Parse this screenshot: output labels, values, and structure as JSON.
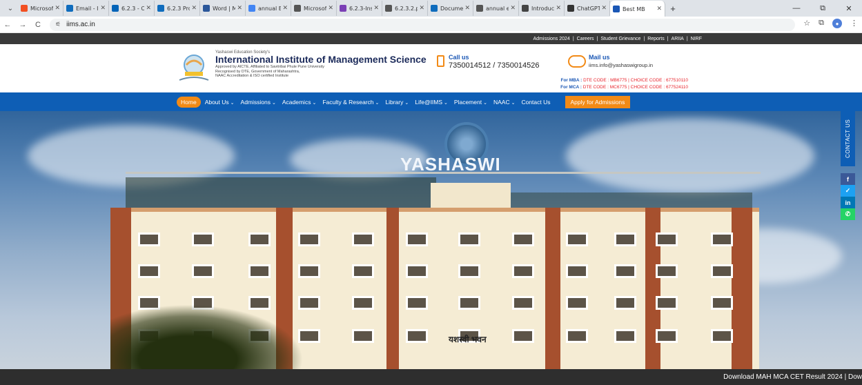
{
  "browser": {
    "tabs": [
      {
        "label": "Microsof",
        "color": "#f25022"
      },
      {
        "label": "Email - I",
        "color": "#0f6cbd"
      },
      {
        "label": "6.2.3 - O",
        "color": "#0364b8"
      },
      {
        "label": "6.2.3 Pro",
        "color": "#0f6cbd"
      },
      {
        "label": "Word | M",
        "color": "#2b579a"
      },
      {
        "label": "annual E",
        "color": "#4285f4"
      },
      {
        "label": "Microsof",
        "color": "#555555"
      },
      {
        "label": "6.2.3-Ins",
        "color": "#7b3fb5"
      },
      {
        "label": "6.2.3.2.p",
        "color": "#555555"
      },
      {
        "label": "Docume",
        "color": "#0f6cbd"
      },
      {
        "label": "annual e",
        "color": "#555555"
      },
      {
        "label": "Introduc",
        "color": "#444444"
      },
      {
        "label": "ChatGPT",
        "color": "#333333"
      },
      {
        "label": "Best MB",
        "color": "#1a57b5",
        "active": true
      }
    ],
    "new_tab": "+",
    "minimize": "—",
    "restore": "⧉",
    "close": "✕",
    "back": "←",
    "forward": "→",
    "reload": "C",
    "url": "iims.ac.in",
    "site_icon": "⚟",
    "star": "☆",
    "extensions": "⧉",
    "menu": "⋮"
  },
  "topstrip": {
    "links": [
      "Admissions 2024",
      "Careers",
      "Student Grievance",
      "Reports",
      "ARIIA",
      "NIRF"
    ]
  },
  "header": {
    "society": "Yashaswi Education Society's",
    "name": "International Institute of Management Science",
    "sub1": "Approved by AICTE, Affiliated to Savitribai Phule Pune University",
    "sub2": "Recognised by DTE, Government of Maharashtra,",
    "sub3": "NAAC Accreditation & ISO certified Institute",
    "call_title": "Call us",
    "call_number": "7350014512 / 7350014526",
    "mail_title": "Mail us",
    "mail_address": "iims.info@yashaswigroup.in",
    "mba_label": "For MBA :",
    "mba_dte": "DTE CODE : MB6775",
    "mba_choice": "CHOICE CODE : 677510110",
    "mca_label": "For MCA :",
    "mca_dte": "DTE CODE : MC6775",
    "mca_choice": "CHOICE CODE : 677524110"
  },
  "nav": {
    "home": "Home",
    "about": "About Us",
    "admissions": "Admissions",
    "academics": "Academics",
    "faculty": "Faculty & Research",
    "library": "Library",
    "life": "Life@IIMS",
    "placement": "Placement",
    "naac": "NAAC",
    "contact": "Contact Us",
    "apply": "Apply for Admissions",
    "chevron": "⌄"
  },
  "hero": {
    "brand_word": "YASHASWI",
    "marathi": "यशस्वी भवन",
    "contact_tab": "CONTACT US",
    "social": [
      {
        "name": "facebook",
        "glyph": "f",
        "color": "#3b5998"
      },
      {
        "name": "twitter",
        "glyph": "✓",
        "color": "#1da1f2"
      },
      {
        "name": "linkedin",
        "glyph": "in",
        "color": "#0077b5"
      },
      {
        "name": "whatsapp",
        "glyph": "✆",
        "color": "#25d366"
      }
    ]
  },
  "ticker": "Download MAH MCA CET Result 2024 | Dow"
}
